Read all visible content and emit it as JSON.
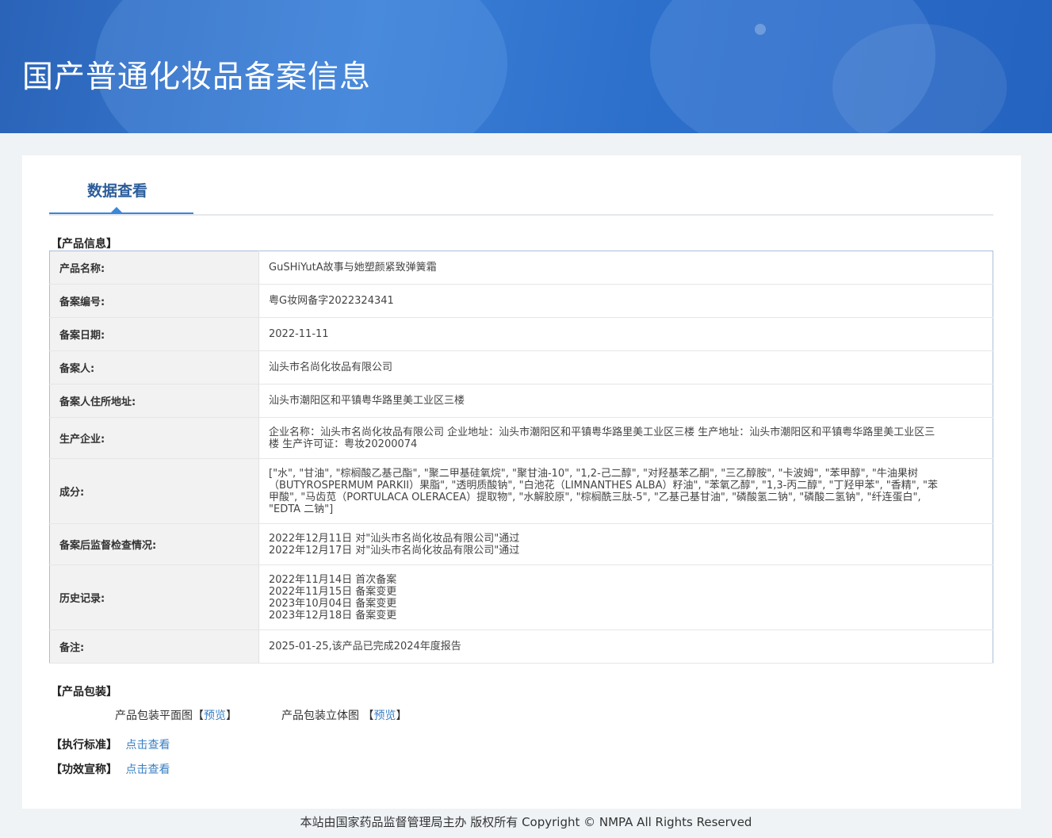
{
  "header": {
    "title": "国产普通化妆品备案信息"
  },
  "tabs": [
    {
      "label": "数据查看"
    }
  ],
  "product_info": {
    "section_label": "【产品信息】",
    "rows": [
      {
        "key": "产品名称:",
        "value": "GuSHiYutA故事与她塑颜紧致弹簧霜"
      },
      {
        "key": "备案编号:",
        "value": "粤G妆网备字2022324341"
      },
      {
        "key": "备案日期:",
        "value": "2022-11-11"
      },
      {
        "key": "备案人:",
        "value": "汕头市名尚化妆品有限公司"
      },
      {
        "key": "备案人住所地址:",
        "value": "汕头市潮阳区和平镇粤华路里美工业区三楼"
      },
      {
        "key": "生产企业:",
        "value": "企业名称：汕头市名尚化妆品有限公司 企业地址：汕头市潮阳区和平镇粤华路里美工业区三楼 生产地址：汕头市潮阳区和平镇粤华路里美工业区三楼 生产许可证：粤妆20200074"
      },
      {
        "key": "成分:",
        "value": "[\"水\", \"甘油\", \"棕榈酸乙基己酯\", \"聚二甲基硅氧烷\", \"聚甘油-10\", \"1,2-己二醇\", \"对羟基苯乙酮\", \"三乙醇胺\", \"卡波姆\", \"苯甲醇\", \"牛油果树（BUTYROSPERMUM PARKII）果脂\", \"透明质酸钠\", \"白池花（LIMNANTHES ALBA）籽油\", \"苯氧乙醇\", \"1,3-丙二醇\", \"丁羟甲苯\", \"香精\", \"苯甲酸\", \"马齿苋（PORTULACA OLERACEA）提取物\", \"水解胶原\", \"棕榈酰三肽-5\", \"乙基己基甘油\", \"磷酸氢二钠\", \"磷酸二氢钠\", \"纤连蛋白\", \"EDTA 二钠\"]"
      },
      {
        "key": "备案后监督检查情况:",
        "lines": [
          "2022年12月11日 对\"汕头市名尚化妆品有限公司\"通过",
          "2022年12月17日 对\"汕头市名尚化妆品有限公司\"通过"
        ]
      },
      {
        "key": "历史记录:",
        "lines": [
          "2022年11月14日 首次备案",
          "2022年11月15日 备案变更",
          "2023年10月04日 备案变更",
          "2023年12月18日 备案变更"
        ]
      },
      {
        "key": "备注:",
        "value": "2025-01-25,该产品已完成2024年度报告"
      }
    ]
  },
  "packaging": {
    "section_label": "【产品包装】",
    "flat_label": "产品包装平面图",
    "stereo_label": "产品包装立体图",
    "bracket_open": "【",
    "bracket_close": "】",
    "preview_link": "预览"
  },
  "standard": {
    "section_label": "【执行标准】",
    "link": "点击查看"
  },
  "efficacy": {
    "section_label": "【功效宣称】",
    "link": "点击查看"
  },
  "footer": {
    "text": "本站由国家药品监督管理局主办 版权所有 Copyright © NMPA All Rights Reserved"
  }
}
